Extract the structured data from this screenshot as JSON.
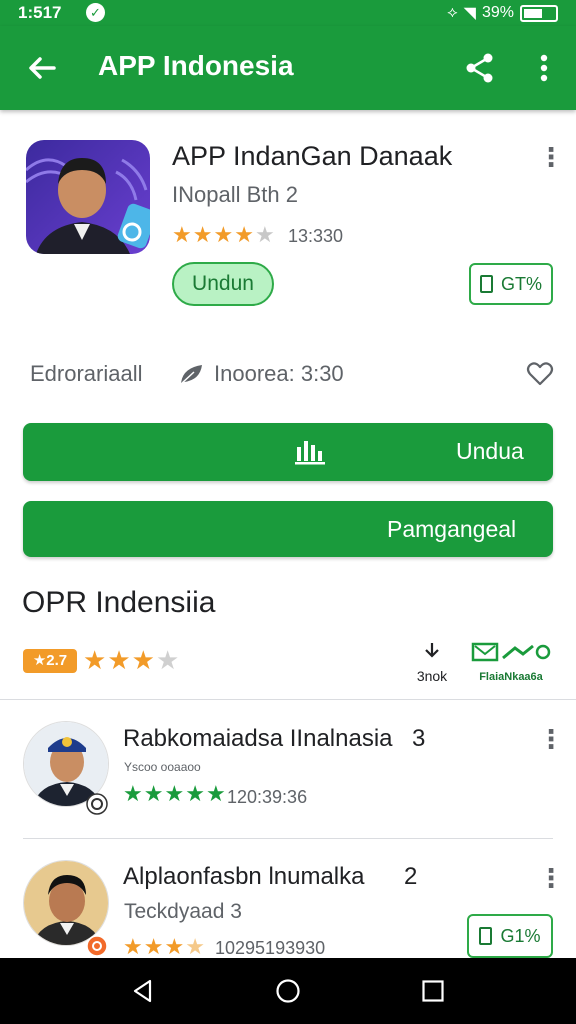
{
  "status_bar": {
    "time": "1:517",
    "battery": "39%"
  },
  "app_bar": {
    "title": "APP Indonesia"
  },
  "app": {
    "name": "APP IndanGan Danaak",
    "developer": "INopall Bth 2",
    "rating": 4,
    "rating_count": "13:330",
    "install_pill": "Undun",
    "compat_chip": "GT%"
  },
  "meta": {
    "category": "Edrorariaall",
    "region": "Inoorea: 3:30"
  },
  "buttons": {
    "primary": "Undua",
    "secondary": "Pamgangeal"
  },
  "section": {
    "title": "OPR Indensiia",
    "rating_badge": "★2.7",
    "rating": 3,
    "stat1_value": "3nok",
    "stat2_value": "FlaiaNkaa6a"
  },
  "list": [
    {
      "title": "Rabkomaiadsa IInalnasia",
      "title_suffix": "3",
      "subtitle": "Yscoo ooaaoo",
      "rating": 4.5,
      "count": "120:39:36"
    },
    {
      "title": "Alplaonfasbn lnumalka",
      "title_suffix": "2",
      "subtitle": "Teckdyaad 3",
      "rating": 3.5,
      "count": "10295193930",
      "chip": "G1%"
    }
  ],
  "colors": {
    "brand_green": "#1a9b3c",
    "star_orange": "#f29b29",
    "star_green": "#1a9b3c",
    "pill_green": "#b9f2c4"
  },
  "icons": [
    "back-arrow-icon",
    "share-icon",
    "more-vert-icon",
    "star-icon",
    "phone-icon",
    "leaf-icon",
    "heart-icon",
    "chart-icon",
    "nav-back-icon",
    "nav-home-icon",
    "nav-recents-icon"
  ]
}
